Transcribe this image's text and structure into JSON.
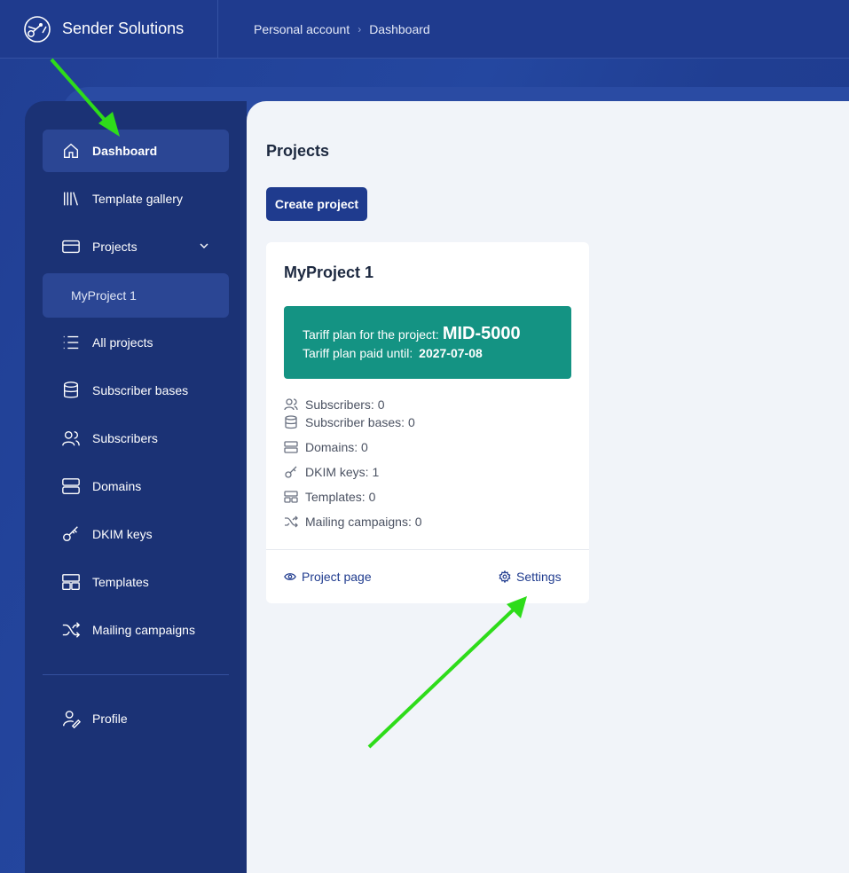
{
  "app": {
    "name": "Sender Solutions"
  },
  "breadcrumb": {
    "parent": "Personal account",
    "separator": "›",
    "current": "Dashboard"
  },
  "sidebar": {
    "items": [
      {
        "label": "Dashboard",
        "icon": "home-icon"
      },
      {
        "label": "Template gallery",
        "icon": "library-icon"
      },
      {
        "label": "Projects",
        "icon": "card-icon"
      },
      {
        "label": "All projects",
        "icon": "list-icon"
      },
      {
        "label": "Subscriber bases",
        "icon": "database-icon"
      },
      {
        "label": "Subscribers",
        "icon": "users-icon"
      },
      {
        "label": "Domains",
        "icon": "server-icon"
      },
      {
        "label": "DKIM keys",
        "icon": "key-icon"
      },
      {
        "label": "Templates",
        "icon": "layout-icon"
      },
      {
        "label": "Mailing campaigns",
        "icon": "shuffle-icon"
      }
    ],
    "sub_item": "MyProject 1",
    "profile": {
      "label": "Profile",
      "icon": "user-edit-icon"
    }
  },
  "main": {
    "title": "Projects",
    "create_button": "Create project",
    "card": {
      "title": "MyProject 1",
      "tariff_label": "Tariff plan for the project:",
      "tariff_plan": "MID-5000",
      "paid_label": "Tariff plan paid until:",
      "paid_date": "2027-07-08",
      "stats": [
        "Subscribers: 0",
        "Subscriber bases: 0",
        "Domains: 0",
        "DKIM keys: 1",
        "Templates: 0",
        "Mailing campaigns: 0"
      ],
      "project_page_link": "Project page",
      "settings_link": "Settings"
    }
  },
  "colors": {
    "header_bg": "#1f3b8e",
    "sidebar_bg": "#1b3275",
    "active_item": "#2b4694",
    "tariff_bg": "#149383",
    "annotation_arrow": "#2edc1a"
  }
}
